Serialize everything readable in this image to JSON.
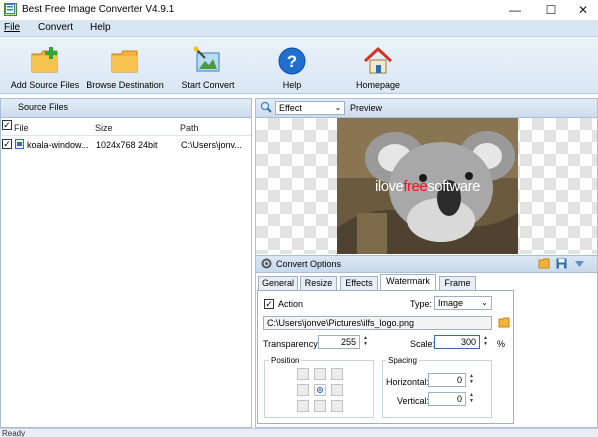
{
  "window": {
    "title": "Best Free Image Converter V4.9.1",
    "minimize": "—",
    "maximize": "☐",
    "close": "✕"
  },
  "menu": {
    "file": "File",
    "convert": "Convert",
    "help": "Help"
  },
  "toolbar": {
    "add_source": "Add Source Files",
    "browse_dest": "Browse Destination",
    "start_convert": "Start Convert",
    "help": "Help",
    "homepage": "Homepage"
  },
  "source_files": {
    "title": "Source Files",
    "columns": {
      "file": "File",
      "size": "Size",
      "path": "Path"
    },
    "rows": [
      {
        "file": "koala-window...",
        "size": "1024x768  24bit",
        "path": "C:\\Users\\jonv..."
      }
    ]
  },
  "preview": {
    "effect_value": "Effect",
    "label": "Preview",
    "watermark_text_a": "ilove",
    "watermark_text_b": "free",
    "watermark_text_c": "software"
  },
  "convert_options": {
    "title": "Convert Options",
    "tabs": [
      "General",
      "Resize",
      "Effects",
      "Watermark",
      "Frame"
    ],
    "active_tab": "Watermark",
    "action_label": "Action",
    "type_label": "Type:",
    "type_value": "Image",
    "file_path": "C:\\Users\\jonve\\Pictures\\ilfs_logo.png",
    "transparency_label": "Transparency:",
    "transparency_value": "255",
    "scale_label": "Scale:",
    "scale_value": "300",
    "percent": "%",
    "position_label": "Position",
    "spacing_label": "Spacing",
    "horizontal_label": "Horizontal:",
    "horizontal_value": "0",
    "vertical_label": "Vertical:",
    "vertical_value": "0"
  },
  "status": {
    "text": "Ready"
  },
  "colors": {
    "menu_bg": "#d8e6f3",
    "accent": "#1e6fd0",
    "watermark_red": "#e21b1b"
  }
}
